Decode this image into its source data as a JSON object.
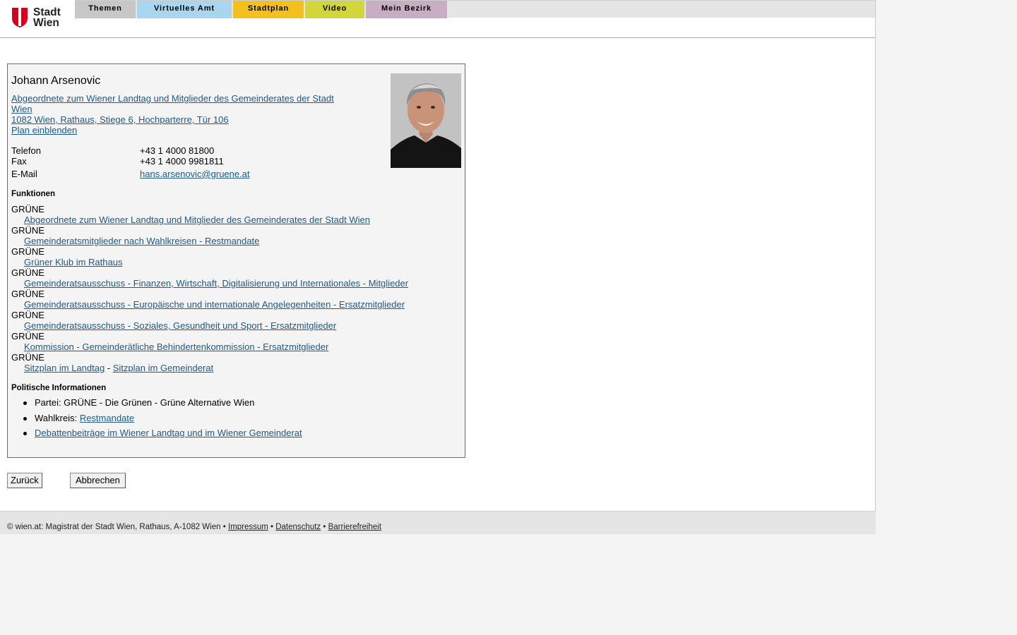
{
  "header": {
    "logo_text_1": "Stadt",
    "logo_text_2": "Wien",
    "nav": [
      {
        "label": "Themen",
        "color": "#c7c7c7"
      },
      {
        "label": "Virtuelles Amt",
        "color": "#a9d6ee"
      },
      {
        "label": "Stadtplan",
        "color": "#f4c01e"
      },
      {
        "label": "Video",
        "color": "#d3d63a"
      },
      {
        "label": "Mein Bezirk",
        "color": "#c9aec3"
      }
    ]
  },
  "person": {
    "name": "Johann Arsenovic",
    "role_line1": "Abgeordnete zum Wiener Landtag und Mitglieder des Gemeinderates der Stadt",
    "role_line2": "Wien ",
    "address": "1082 Wien, Rathaus, Stiege 6, Hochparterre, Tür 106",
    "plan": "Plan einblenden",
    "contacts": [
      {
        "label": "Telefon",
        "value": "+43 1 4000 81800"
      },
      {
        "label": "Fax",
        "value": "+43 1 4000 9981811"
      },
      {
        "label": "E-Mail",
        "value": "hans.arsenovic@gruene.at"
      }
    ]
  },
  "functions": {
    "heading": "Funktionen",
    "items": [
      {
        "party": "GRÜNE",
        "link": "Abgeordnete zum Wiener Landtag und Mitglieder des Gemeinderates der Stadt Wien"
      },
      {
        "party": "GRÜNE",
        "link": "Gemeinderatsmitglieder nach Wahlkreisen - Restmandate"
      },
      {
        "party": "GRÜNE",
        "link": "Grüner Klub im Rathaus"
      },
      {
        "party": "GRÜNE",
        "link": "Gemeinderatsausschuss - Finanzen, Wirtschaft, Digitalisierung und Internationales - Mitglieder"
      },
      {
        "party": "GRÜNE",
        "link": "Gemeinderatsausschuss - Europäische und internationale Angelegenheiten - Ersatzmitglieder"
      },
      {
        "party": "GRÜNE",
        "link": "Gemeinderatsausschuss - Soziales, Gesundheit und Sport - Ersatzmitglieder"
      },
      {
        "party": "GRÜNE",
        "link": "Kommission - Gemeinderätliche Behindertenkommission - Ersatzmitglieder"
      }
    ],
    "last_party": "GRÜNE",
    "seat_link1": "Sitzplan im Landtag",
    "seat_sep": " - ",
    "seat_link2": "Sitzplan im Gemeinderat"
  },
  "political": {
    "heading": "Politische Informationen",
    "party_text": "Partei: GRÜNE - Die Grünen - Grüne Alternative Wien",
    "wahlkreis_label": "Wahlkreis: ",
    "wahlkreis_link": "Restmandate",
    "debates_link": "Debattenbeiträge im Wiener Landtag und im Wiener Gemeinderat"
  },
  "buttons": {
    "back": "Zurück",
    "cancel": "Abbrechen"
  },
  "footer": {
    "copyright": "© wien.at: Magistrat der Stadt Wien, Rathaus, A-1082 Wien",
    "sep": " • ",
    "impressum": "Impressum",
    "datenschutz": "Datenschutz",
    "barrierefreiheit": "Barrierefreiheit"
  }
}
